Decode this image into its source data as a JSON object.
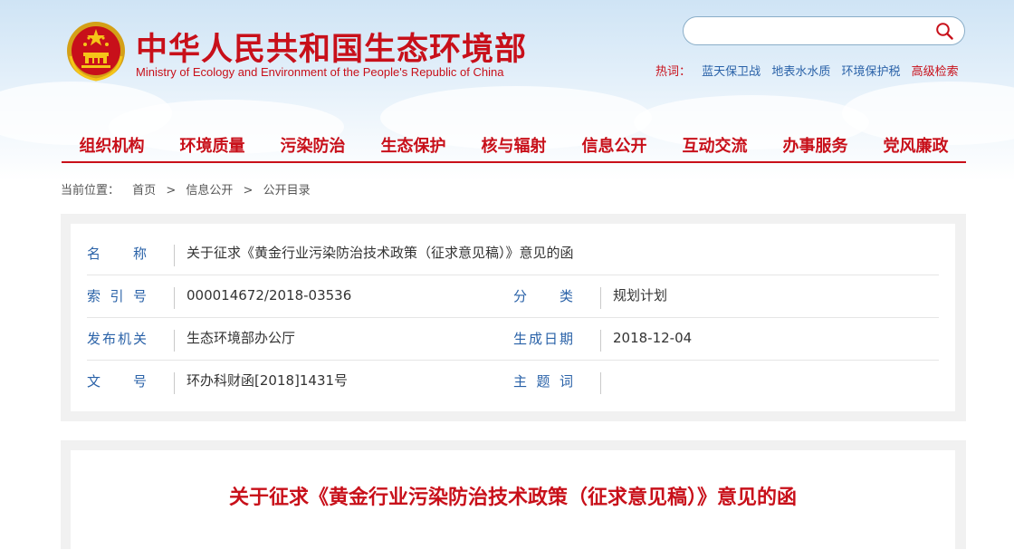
{
  "header": {
    "title_cn": "中华人民共和国生态环境部",
    "title_en": "Ministry of Ecology and Environment of the People's Republic of China",
    "emblem_icon": "national-emblem-icon"
  },
  "search": {
    "placeholder": "",
    "value": "",
    "icon": "search-icon"
  },
  "hot_search": {
    "label": "热词：",
    "items": [
      "蓝天保卫战",
      "地表水水质",
      "环境保护税"
    ],
    "advanced": "高级检索"
  },
  "nav": {
    "items": [
      "组织机构",
      "环境质量",
      "污染防治",
      "生态保护",
      "核与辐射",
      "信息公开",
      "互动交流",
      "办事服务",
      "党风廉政"
    ]
  },
  "breadcrumb": {
    "label": "当前位置：",
    "items": [
      "首页",
      "信息公开",
      "公开目录"
    ],
    "separator": ">"
  },
  "info": {
    "name_label": "名　称",
    "name_value": "关于征求《黄金行业污染防治技术政策（征求意见稿）》意见的函",
    "index_label": "索引号",
    "index_value": "000014672/2018-03536",
    "category_label": "分　类",
    "category_value": "规划计划",
    "issuer_label": "发布机关",
    "issuer_value": "生态环境部办公厅",
    "date_label": "生成日期",
    "date_value": "2018-12-04",
    "docno_label": "文　号",
    "docno_value": "环办科财函[2018]1431号",
    "subject_label": "主题词",
    "subject_value": ""
  },
  "article": {
    "title": "关于征求《黄金行业污染防治技术政策（征求意见稿）》意见的函"
  },
  "colors": {
    "brand_red": "#c8101a",
    "label_blue": "#2a62a8",
    "sky_blue": "#cfe4f5"
  }
}
